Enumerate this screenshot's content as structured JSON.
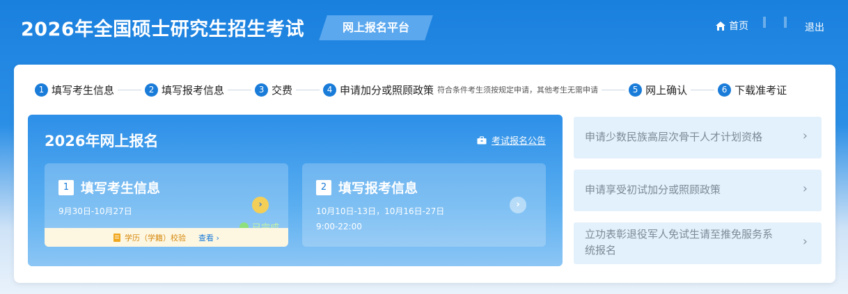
{
  "header": {
    "title": "2026年全国硕士研究生招生考试",
    "platform_tag": "网上报名平台",
    "home_label": "首页",
    "logout_label": "退出"
  },
  "steps": [
    {
      "num": "1",
      "label": "填写考生信息"
    },
    {
      "num": "2",
      "label": "填写报考信息"
    },
    {
      "num": "3",
      "label": "交费"
    },
    {
      "num": "4",
      "label": "申请加分或照顾政策",
      "note": "符合条件考生须按规定申请，其他考生无需申请"
    },
    {
      "num": "5",
      "label": "网上确认"
    },
    {
      "num": "6",
      "label": "下载准考证"
    }
  ],
  "panel": {
    "title": "2026年网上报名",
    "notice_link": "考试报名公告",
    "cards": [
      {
        "num": "1",
        "title": "填写考生信息",
        "dates": "9月30日-10月27日",
        "status": "已完成",
        "footer_text": "学历（学籍）校验",
        "footer_link": "查看"
      },
      {
        "num": "2",
        "title": "填写报考信息",
        "dates": "10月10日-13日，10月16日-27日",
        "time": "9:00-22:00"
      }
    ]
  },
  "side_items": [
    {
      "label": "申请少数民族高层次骨干人才计划资格"
    },
    {
      "label": "申请享受初试加分或照顾政策"
    },
    {
      "label_line1": "立功表彰退役军人免试生请至推免服务系",
      "label_line2": "统报名"
    }
  ],
  "colors": {
    "header_blue": "#1a80de",
    "accent": "#1a7cd9",
    "arrow_active": "#f4cf58",
    "status_green": "#8fe07c"
  }
}
